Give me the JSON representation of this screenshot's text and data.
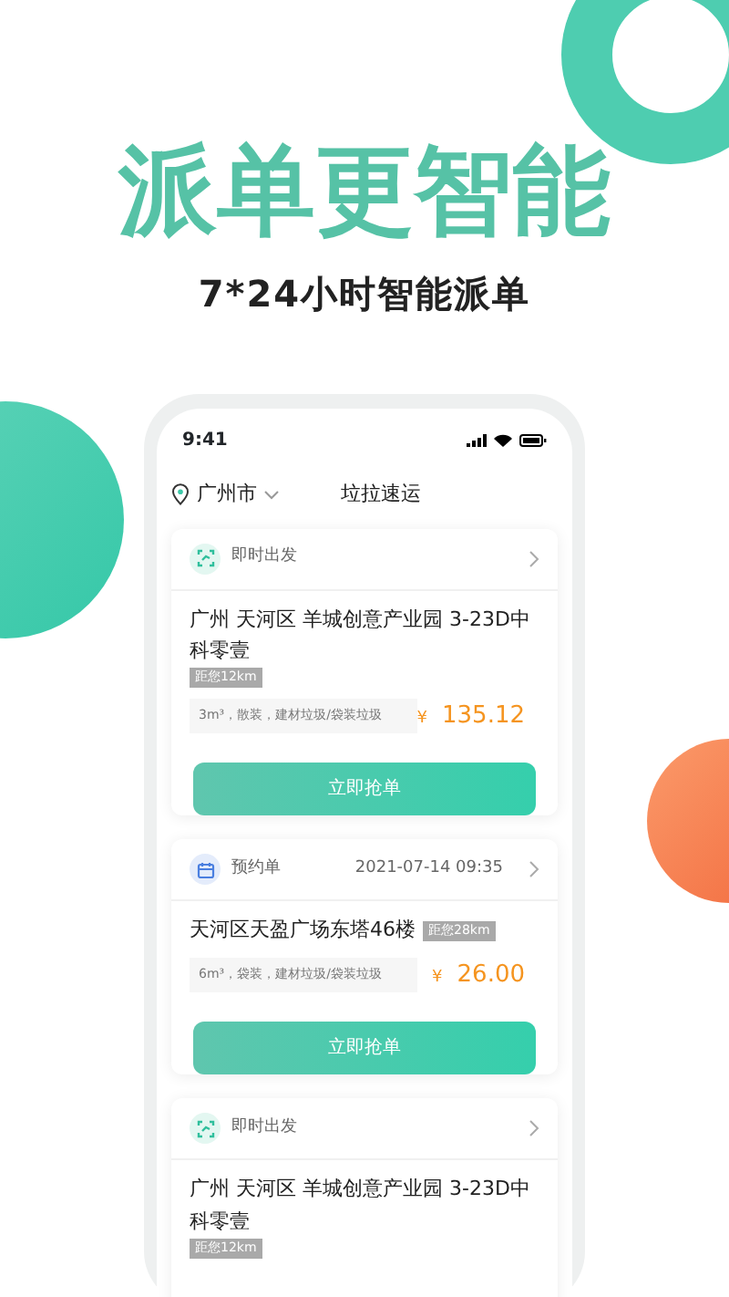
{
  "headline": "派单更智能",
  "subtitle": "7*24小时智能派单",
  "phone": {
    "status_time": "9:41",
    "city": "广州市",
    "app_title": "垃拉速运"
  },
  "orders": [
    {
      "kind": "instant",
      "type_label": "即时出发",
      "address": "广州 天河区 羊城创意产业园 3-23D中科零壹",
      "distance": "距您12km",
      "spec": "3m³，散装，建材垃圾/袋装垃圾",
      "currency": "¥",
      "price": "135.12",
      "action": "立即抢单"
    },
    {
      "kind": "booking",
      "type_label": "预约单",
      "time": "2021-07-14 09:35",
      "address": "天河区天盈广场东塔46楼",
      "distance": "距您28km",
      "spec": "6m³，袋装，建材垃圾/袋装垃圾",
      "currency": "¥",
      "price": "26.00",
      "action": "立即抢单"
    },
    {
      "kind": "instant",
      "type_label": "即时出发",
      "address": "广州 天河区 羊城创意产业园 3-23D中科零壹",
      "distance": "距您12km"
    }
  ]
}
